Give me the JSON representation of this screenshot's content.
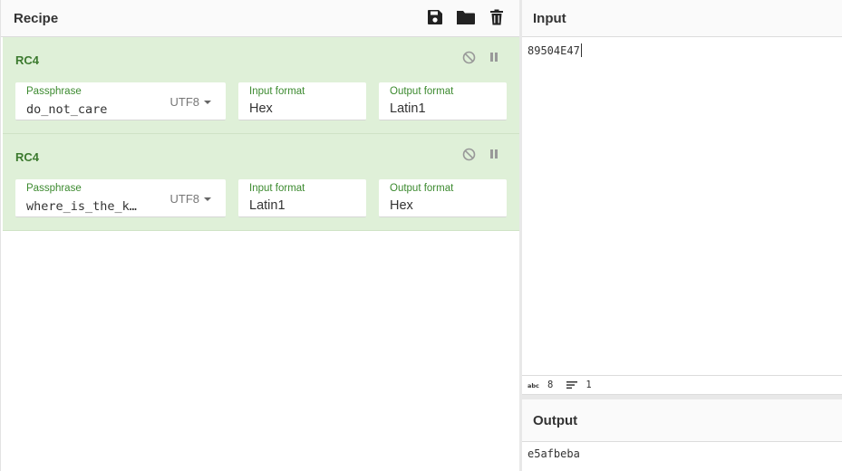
{
  "recipe": {
    "title": "Recipe",
    "icons": [
      "save-icon",
      "folder-icon",
      "trash-icon"
    ],
    "operations": [
      {
        "name": "RC4",
        "passphrase_label": "Passphrase",
        "passphrase_value": "do_not_care",
        "encoding": "UTF8",
        "input_format_label": "Input format",
        "input_format_value": "Hex",
        "output_format_label": "Output format",
        "output_format_value": "Latin1"
      },
      {
        "name": "RC4",
        "passphrase_label": "Passphrase",
        "passphrase_value": "where_is_the_k…",
        "encoding": "UTF8",
        "input_format_label": "Input format",
        "input_format_value": "Latin1",
        "output_format_label": "Output format",
        "output_format_value": "Hex"
      }
    ]
  },
  "input": {
    "title": "Input",
    "text": "89504E47",
    "status": {
      "length_icon": "abc-icon",
      "length": "8",
      "lines_icon": "lines-icon",
      "lines": "1"
    }
  },
  "output": {
    "title": "Output",
    "text": "e5afbeba"
  },
  "colors": {
    "op_bg": "#dff0d8",
    "op_title": "#3c7a2f",
    "label_green": "#3c8a2f"
  }
}
